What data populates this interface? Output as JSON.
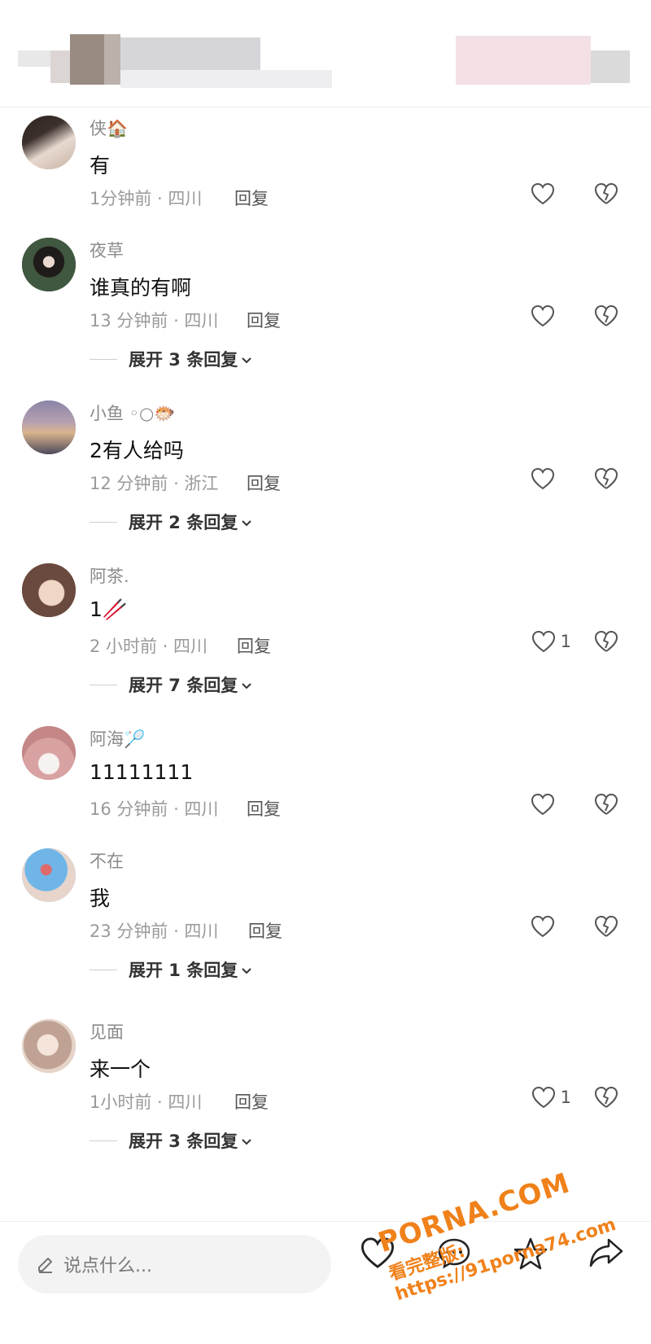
{
  "comments": [
    {
      "name": "侠🏠",
      "text": "有",
      "time": "1分钟前 · 四川",
      "reply": "回复",
      "likes": "",
      "expand": ""
    },
    {
      "name": "夜草",
      "text": "谁真的有啊",
      "time": "13 分钟前 · 四川",
      "reply": "回复",
      "likes": "",
      "expand": "展开 3 条回复"
    },
    {
      "name": "小鱼 ◦○🐡",
      "text": "2有人给吗",
      "time": "12 分钟前 · 浙江",
      "reply": "回复",
      "likes": "",
      "expand": "展开 2 条回复"
    },
    {
      "name": "阿茶.",
      "text": "1🥢",
      "time": "2 小时前 · 四川",
      "reply": "回复",
      "likes": "1",
      "expand": "展开 7 条回复"
    },
    {
      "name": "阿海🏸",
      "text": "11111111",
      "time": "16 分钟前 · 四川",
      "reply": "回复",
      "likes": "",
      "expand": ""
    },
    {
      "name": "不在",
      "text": "我",
      "time": "23 分钟前 · 四川",
      "reply": "回复",
      "likes": "",
      "expand": "展开 1 条回复"
    },
    {
      "name": "见面",
      "text": "来一个",
      "time": "1小时前 · 四川",
      "reply": "回复",
      "likes": "1",
      "expand": "展开 3 条回复"
    }
  ],
  "avatars": [
    {
      "color_a": "#3c302c",
      "color_b": "#d8c7bd"
    },
    {
      "color_a": "#1a2a1e",
      "color_b": "#6f8a6a"
    },
    {
      "color_a": "#6a6a8c",
      "color_b": "#d9b48c"
    },
    {
      "color_a": "#6a4a3e",
      "color_b": "#e7cbb8"
    },
    {
      "color_a": "#c9a0a0",
      "color_b": "#f1e2e0"
    },
    {
      "color_a": "#6fb5e8",
      "color_b": "#e08a8a"
    },
    {
      "color_a": "#cfb7aa",
      "color_b": "#f2e6df"
    }
  ],
  "input": {
    "placeholder": "说点什么..."
  },
  "icons": {
    "like": "heart-icon",
    "dislike": "broken-heart-icon",
    "edit": "pencil-icon",
    "chevron": "chevron-down-icon",
    "share": "share-icon",
    "comment": "comment-icon",
    "favorite": "star-icon"
  },
  "watermark": {
    "line1": "PORNA.COM",
    "line2": "看完整版: https://91porna74.com"
  }
}
